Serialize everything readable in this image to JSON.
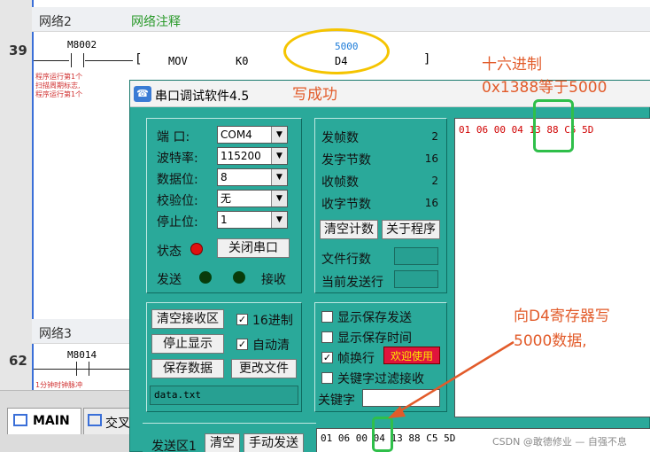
{
  "ladder": {
    "net2_label": "网络2",
    "net2_comment": "网络注释",
    "net2_line": "39",
    "net2_contact": "M8002",
    "net2_instr": "MOV",
    "net2_src": "K0",
    "net2_dst": "D4",
    "net2_monitor": "5000",
    "net2_note1": "程序运行第1个",
    "net2_note2": "扫描周期标志,",
    "net2_note3": "程序运行第1个",
    "net3_label": "网络3",
    "net3_line": "62",
    "net3_contact": "M8014",
    "net3_note": "1分钟时钟脉冲"
  },
  "tabs": {
    "main": "MAIN",
    "next": "交叉"
  },
  "dialog": {
    "title": "串口调试软件4.5",
    "port_label": "端  口:",
    "port_value": "COM4",
    "baud_label": "波特率:",
    "baud_value": "115200",
    "databits_label": "数据位:",
    "databits_value": "8",
    "parity_label": "校验位:",
    "parity_value": "无",
    "stopbits_label": "停止位:",
    "stopbits_value": "1",
    "status_label": "状态",
    "close_port": "关闭串口",
    "send_label": "发送",
    "recv_label": "接收",
    "sent_frames_label": "发帧数",
    "sent_frames": "2",
    "sent_bytes_label": "发字节数",
    "sent_bytes": "16",
    "recv_frames_label": "收帧数",
    "recv_frames": "2",
    "recv_bytes_label": "收字节数",
    "recv_bytes": "16",
    "clear_count": "清空计数",
    "about": "关于程序",
    "file_lines_label": "文件行数",
    "current_line_label": "当前发送行",
    "recv_text": "01 06 00 04 13 88 C5 5D",
    "clear_recv": "清空接收区",
    "hex_label": "16进制",
    "stop_display": "停止显示",
    "auto_clear": "自动清",
    "save_data": "保存数据",
    "change_file": "更改文件",
    "file_name": "data.txt",
    "show_save_send": "显示保存发送",
    "show_save_time": "显示保存时间",
    "frame_newline": "帧换行",
    "welcome": "欢迎使用",
    "keyword_filter": "关键字过滤接收",
    "keyword_label": "关键字",
    "send_area_label": "发送区1",
    "clear": "清空",
    "manual_send": "手动发送",
    "send_text": "01 06 00 04 13 88  C5 5D"
  },
  "annotations": {
    "write_ok": "写成功",
    "hex_title": "十六进制",
    "hex_eq": "0x1388等于5000",
    "write_d4_1": "向D4寄存器写",
    "write_d4_2": "5000数据,",
    "watermark": "CSDN @敢德修业 — 自强不息"
  },
  "colors": {
    "dialog_bg": "#2aa99a",
    "annotation": "#e25b2a",
    "highlight_green": "#2fbf4a",
    "ellipse_yellow": "#f5c400",
    "welcome_bg": "#e0143c"
  }
}
